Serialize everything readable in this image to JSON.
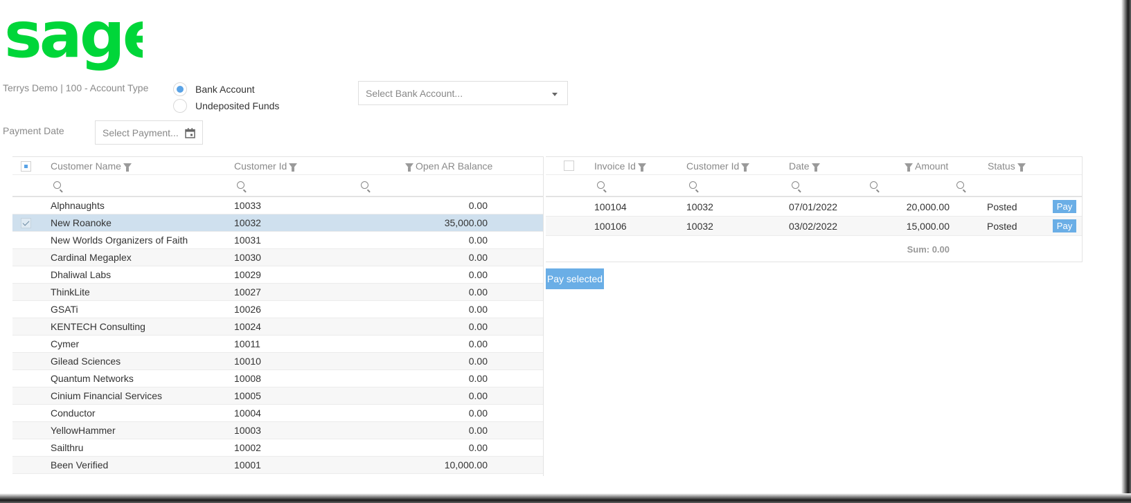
{
  "brand": {
    "logo_text": "Sage",
    "color": "#00d639"
  },
  "filters": {
    "account_type_label": "Terrys Demo | 100 - Account Type",
    "radio_options": [
      {
        "label": "Bank Account",
        "selected": true
      },
      {
        "label": "Undeposited Funds",
        "selected": false
      }
    ],
    "bank_account_placeholder": "Select Bank Account...",
    "payment_date_label": "Payment Date",
    "payment_date_placeholder": "Select Payment..."
  },
  "customers": {
    "headers": {
      "name": "Customer Name",
      "id": "Customer Id",
      "balance": "Open AR Balance"
    },
    "rows": [
      {
        "name": "Alphnaughts",
        "id": "10033",
        "balance": "0.00",
        "selected": false
      },
      {
        "name": "New Roanoke",
        "id": "10032",
        "balance": "35,000.00",
        "selected": true
      },
      {
        "name": "New Worlds Organizers of Faith",
        "id": "10031",
        "balance": "0.00",
        "selected": false
      },
      {
        "name": "Cardinal Megaplex",
        "id": "10030",
        "balance": "0.00",
        "selected": false
      },
      {
        "name": "Dhaliwal Labs",
        "id": "10029",
        "balance": "0.00",
        "selected": false
      },
      {
        "name": "ThinkLite",
        "id": "10027",
        "balance": "0.00",
        "selected": false
      },
      {
        "name": "GSATi",
        "id": "10026",
        "balance": "0.00",
        "selected": false
      },
      {
        "name": "KENTECH Consulting",
        "id": "10024",
        "balance": "0.00",
        "selected": false
      },
      {
        "name": "Cymer",
        "id": "10011",
        "balance": "0.00",
        "selected": false
      },
      {
        "name": "Gilead Sciences",
        "id": "10010",
        "balance": "0.00",
        "selected": false
      },
      {
        "name": "Quantum Networks",
        "id": "10008",
        "balance": "0.00",
        "selected": false
      },
      {
        "name": "Cinium Financial Services",
        "id": "10005",
        "balance": "0.00",
        "selected": false
      },
      {
        "name": "Conductor",
        "id": "10004",
        "balance": "0.00",
        "selected": false
      },
      {
        "name": "YellowHammer",
        "id": "10003",
        "balance": "0.00",
        "selected": false
      },
      {
        "name": "Sailthru",
        "id": "10002",
        "balance": "0.00",
        "selected": false
      },
      {
        "name": "Been Verified",
        "id": "10001",
        "balance": "10,000.00",
        "selected": false
      }
    ]
  },
  "invoices": {
    "headers": {
      "invoice_id": "Invoice Id",
      "customer_id": "Customer Id",
      "date": "Date",
      "amount": "Amount",
      "status": "Status"
    },
    "rows": [
      {
        "invoice_id": "100104",
        "customer_id": "10032",
        "date": "07/01/2022",
        "amount": "20,000.00",
        "status": "Posted",
        "action": "Pay"
      },
      {
        "invoice_id": "100106",
        "customer_id": "10032",
        "date": "03/02/2022",
        "amount": "15,000.00",
        "status": "Posted",
        "action": "Pay"
      }
    ],
    "sum_label": "Sum: 0.00",
    "pay_selected_label": "Pay selected"
  },
  "icons": [
    "search-icon",
    "filter-icon",
    "calendar-icon",
    "chevron-down-icon"
  ],
  "colors": {
    "accent": "#6aaee6",
    "selected_row": "#cfe0ee"
  }
}
